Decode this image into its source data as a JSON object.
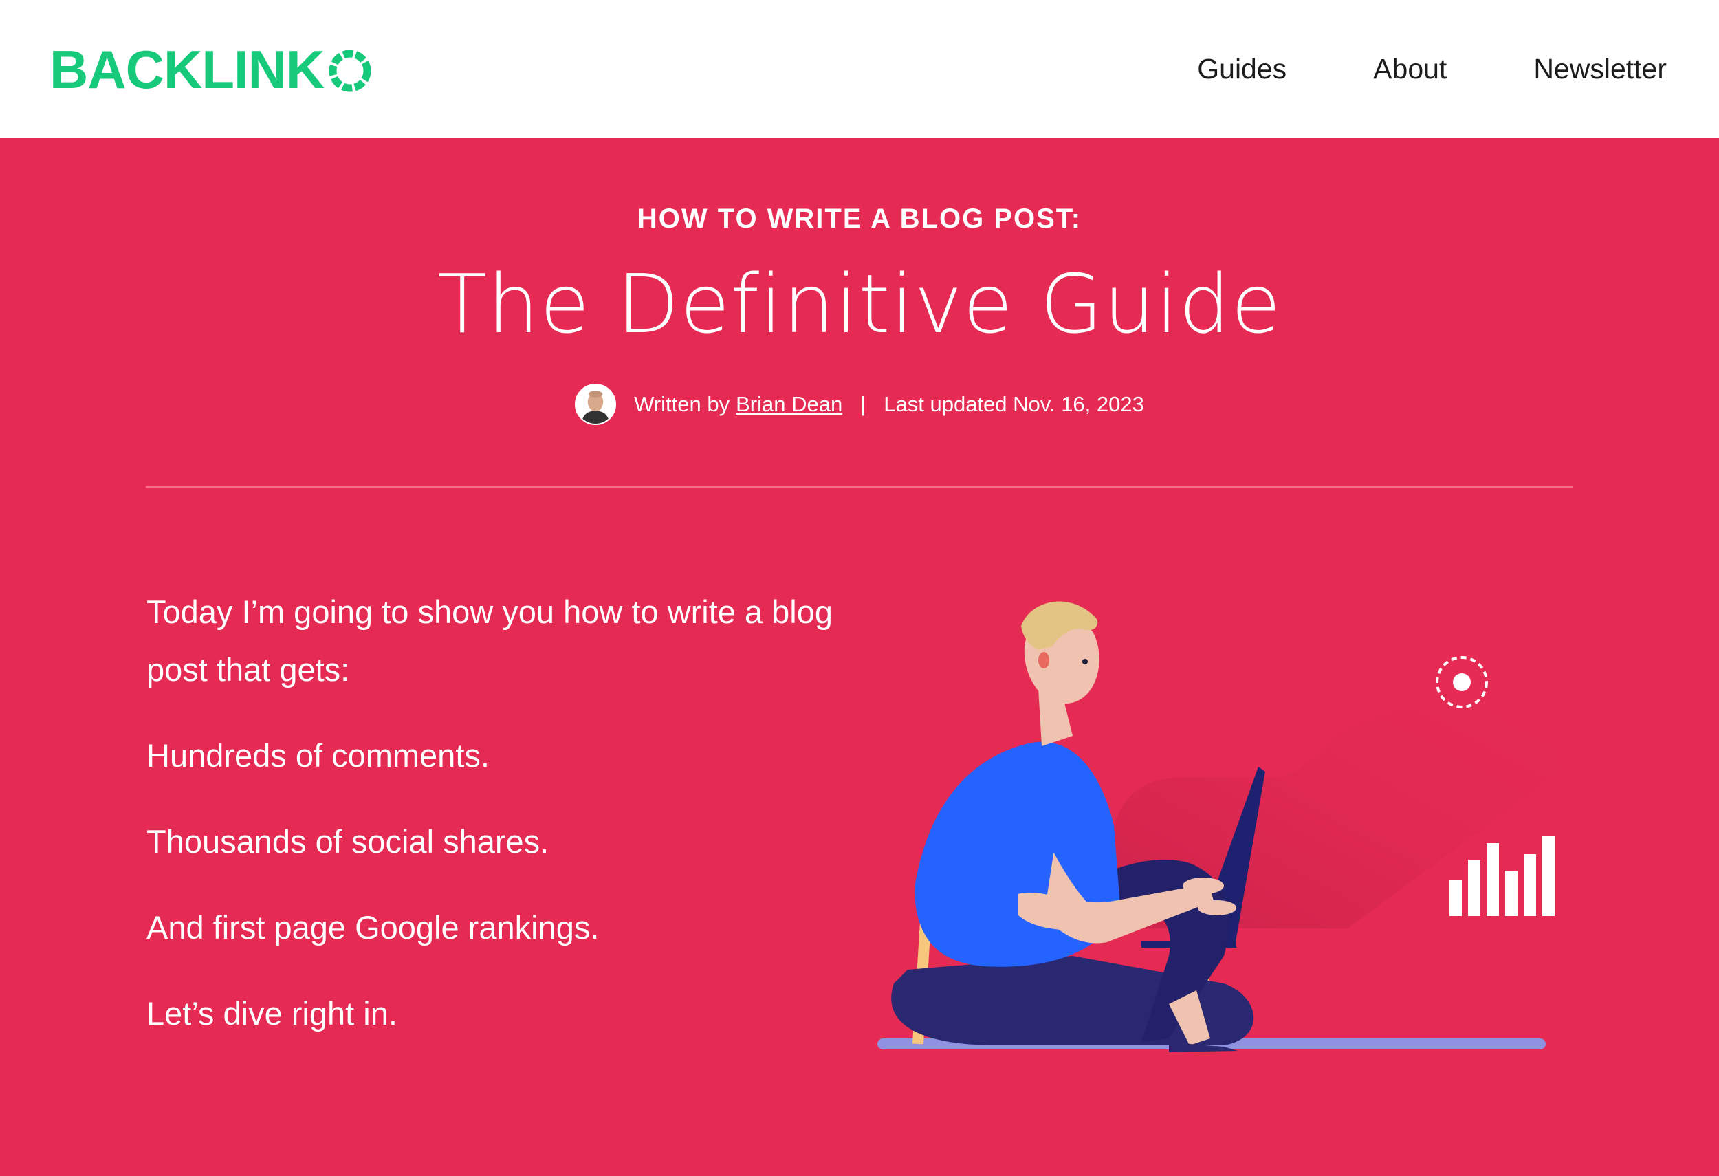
{
  "header": {
    "logo_text": "BACKLINK",
    "brand_color": "#17c97a",
    "nav": [
      {
        "label": "Guides"
      },
      {
        "label": "About"
      },
      {
        "label": "Newsletter"
      }
    ]
  },
  "hero": {
    "background_color": "#e52b53",
    "eyebrow": "HOW TO WRITE A BLOG POST:",
    "title": "The Definitive Guide",
    "meta": {
      "written_by": "Written by",
      "author": "Brian Dean",
      "separator": "|",
      "updated": "Last updated Nov. 16, 2023"
    }
  },
  "intro": {
    "paragraphs": [
      "Today I’m going to show you how to write a blog post that gets:",
      "Hundreds of comments.",
      "Thousands of social shares.",
      "And first page Google rankings.",
      "Let’s dive right in."
    ]
  }
}
